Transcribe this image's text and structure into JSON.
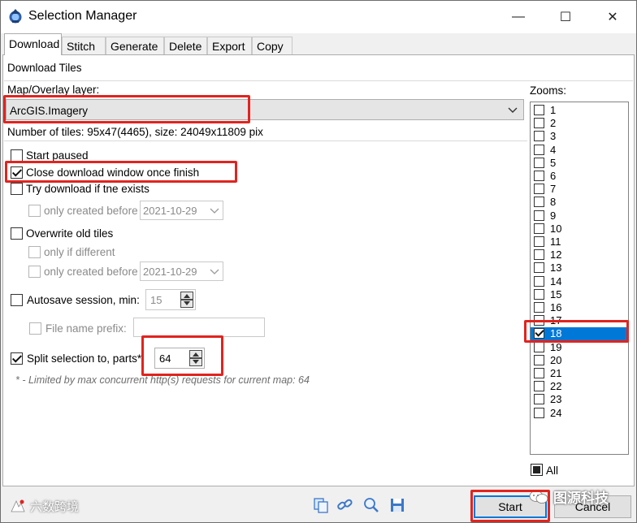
{
  "window": {
    "title": "Selection Manager",
    "controls": {
      "minimize": "—",
      "maximize": "☐",
      "close": "✕"
    }
  },
  "tabs": [
    "Download",
    "Stitch",
    "Generate",
    "Delete",
    "Export",
    "Copy"
  ],
  "active_tab": "Download",
  "panel": {
    "section_title": "Download Tiles",
    "layer_label": "Map/Overlay layer:",
    "layer_value": "ArcGIS.Imagery",
    "tiles_info": "Number of tiles: 95x47(4465), size: 24049x11809 pix"
  },
  "options": {
    "start_paused": {
      "label": "Start paused",
      "checked": false
    },
    "close_window": {
      "label": "Close download window once finish",
      "checked": true
    },
    "try_download": {
      "label": "Try download if tne exists",
      "checked": false
    },
    "try_only_created": {
      "label": "only created before",
      "date": "2021-10-29",
      "checked": false
    },
    "overwrite": {
      "label": "Overwrite old tiles",
      "checked": false
    },
    "only_if_different": {
      "label": "only if different",
      "checked": false
    },
    "overwrite_only_created": {
      "label": "only created before",
      "date": "2021-10-29",
      "checked": false
    },
    "autosave": {
      "label": "Autosave session, min:",
      "value": "15",
      "checked": false
    },
    "file_prefix": {
      "label": "File name prefix:",
      "value": "",
      "checked": false
    },
    "split": {
      "label": "Split selection to, parts*:",
      "value": "64",
      "checked": true
    }
  },
  "note": "* - Limited by max concurrent http(s) requests for current map: 64",
  "zooms": {
    "label": "Zooms:",
    "levels": [
      "1",
      "2",
      "3",
      "4",
      "5",
      "6",
      "7",
      "8",
      "9",
      "10",
      "11",
      "12",
      "13",
      "14",
      "15",
      "16",
      "17",
      "18",
      "19",
      "20",
      "21",
      "22",
      "23",
      "24"
    ],
    "checked": [
      "18"
    ],
    "selected": "18",
    "all_label": "All"
  },
  "buttons": {
    "start": "Start",
    "cancel": "Cancel"
  },
  "watermarks": {
    "left": "六数跨境",
    "right": "图源科技"
  },
  "colors": {
    "highlight": "#e0241f",
    "selection": "#0078d7"
  }
}
